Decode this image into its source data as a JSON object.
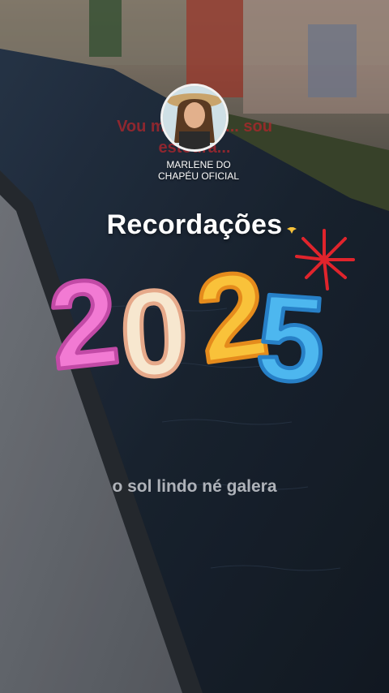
{
  "story": {
    "background_caption": "Vou mostrar p... sou\nestoura...",
    "creator_name": "MARLENE DO\nCHAPÉU OFICIAL",
    "title": "Recordações",
    "year_digits": [
      "2",
      "0",
      "2",
      "5"
    ],
    "subtitle": "o sol lindo né galera"
  },
  "colors": {
    "digit_pink": "#f27ad3",
    "digit_cream": "#f7e7cf",
    "digit_yellow": "#f9c23a",
    "digit_blue": "#4db7ef",
    "firework": "#e0242c",
    "water": "#1d2a3a",
    "walkway": "#6e727a"
  },
  "icons": [
    "avatar-photo",
    "firework-icon",
    "sparkle-icon"
  ]
}
